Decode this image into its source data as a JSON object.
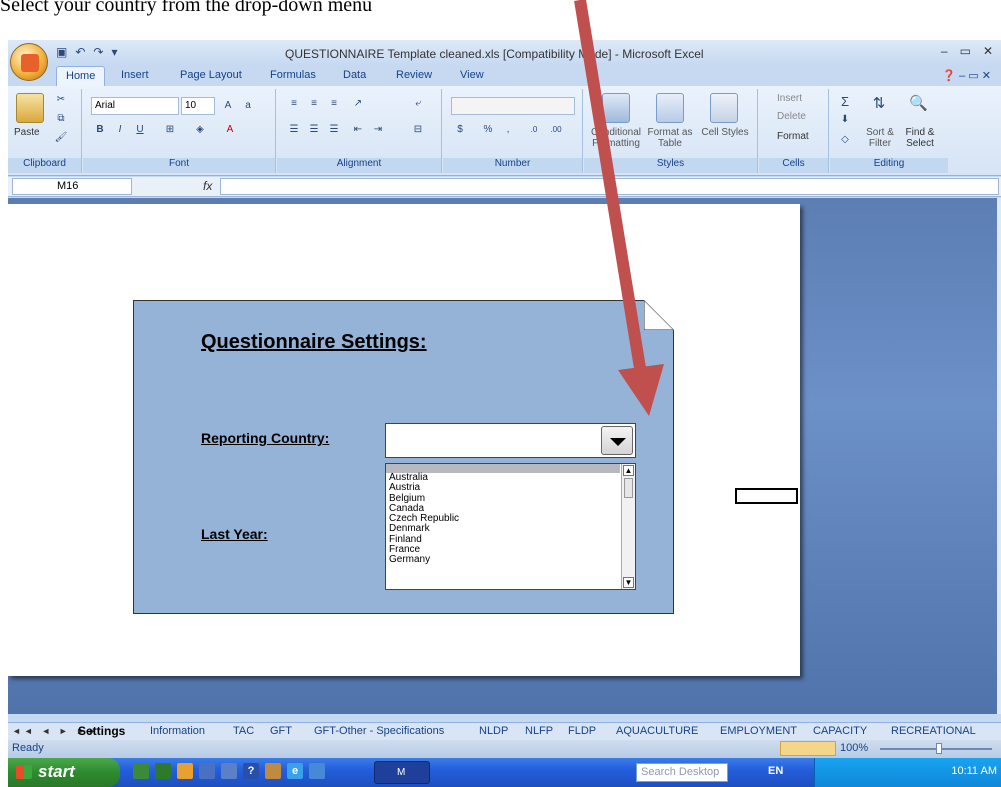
{
  "instruction": "Select your country from the drop-down menu",
  "window": {
    "title": "QUESTIONNAIRE Template cleaned.xls  [Compatibility Mode] - Microsoft Excel",
    "minimize": "–",
    "restore": "▭",
    "close": "✕"
  },
  "ribbon": {
    "tabs": [
      "Home",
      "Insert",
      "Page Layout",
      "Formulas",
      "Data",
      "Review",
      "View"
    ],
    "font_name": "Arial",
    "font_size": "10",
    "groups": {
      "clipboard": "Clipboard",
      "font": "Font",
      "alignment": "Alignment",
      "number": "Number",
      "styles": "Styles",
      "cells": "Cells",
      "editing": "Editing"
    },
    "paste": "Paste",
    "styles_buttons": [
      "Conditional Formatting",
      "Format as Table",
      "Cell Styles"
    ],
    "cells_buttons": [
      "Insert",
      "Delete",
      "Format"
    ],
    "editing_buttons": [
      "Sort & Filter",
      "Find & Select"
    ]
  },
  "formula_bar": {
    "name_box": "M16",
    "fx": "fx",
    "value": ""
  },
  "form": {
    "title": "Questionnaire Settings:",
    "country_label": "Reporting Country:",
    "year_label": "Last Year:",
    "country_value": "",
    "country_options": [
      "Australia",
      "Austria",
      "Belgium",
      "Canada",
      "Czech Republic",
      "Denmark",
      "Finland",
      "France",
      "Germany"
    ]
  },
  "sheet_tabs": [
    "Settings",
    "Information",
    "TAC",
    "GFT",
    "GFT-Other - Specifications",
    "NLDP",
    "NLFP",
    "FLDP",
    "AQUACULTURE",
    "EMPLOYMENT",
    "CAPACITY",
    "RECREATIONAL"
  ],
  "status": {
    "ready": "Ready",
    "zoom": "100%"
  },
  "taskbar": {
    "start": "start",
    "excel_task": "M",
    "search_placeholder": "Search Desktop",
    "language": "EN",
    "clock": "10:11 AM"
  },
  "colors": {
    "annotation_arrow": "#c0504d",
    "form_background": "#95b3d7",
    "taskbar": "#245edc"
  }
}
